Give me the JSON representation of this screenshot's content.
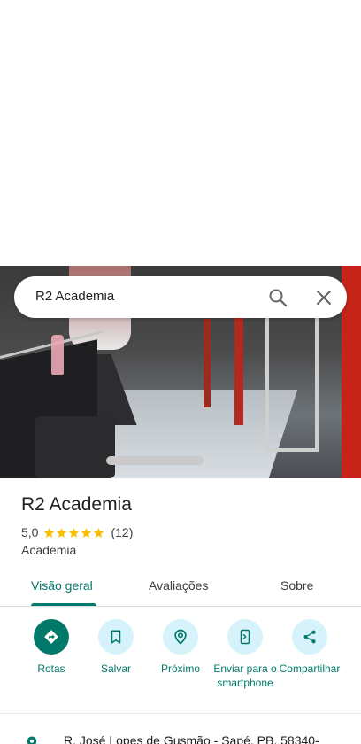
{
  "search": {
    "query": "R2 Academia"
  },
  "place": {
    "name": "R2 Academia",
    "rating": "5,0",
    "stars": 5,
    "review_count": "(12)",
    "category": "Academia"
  },
  "tabs": [
    {
      "label": "Visão geral",
      "active": true
    },
    {
      "label": "Avaliações",
      "active": false
    },
    {
      "label": "Sobre",
      "active": false
    }
  ],
  "actions": [
    {
      "label": "Rotas",
      "icon": "directions-icon"
    },
    {
      "label": "Salvar",
      "icon": "bookmark-icon"
    },
    {
      "label": "Próximo",
      "icon": "nearby-icon"
    },
    {
      "label": "Enviar para o smartphone",
      "icon": "send-to-phone-icon"
    },
    {
      "label": "Compartilhar",
      "icon": "share-icon"
    }
  ],
  "address": {
    "text": "R. José Lopes de Gusmão - Sapé, PB, 58340-"
  },
  "colors": {
    "accent": "#00796b",
    "action_bg": "#d6f3fb",
    "star": "#fbbc04"
  }
}
